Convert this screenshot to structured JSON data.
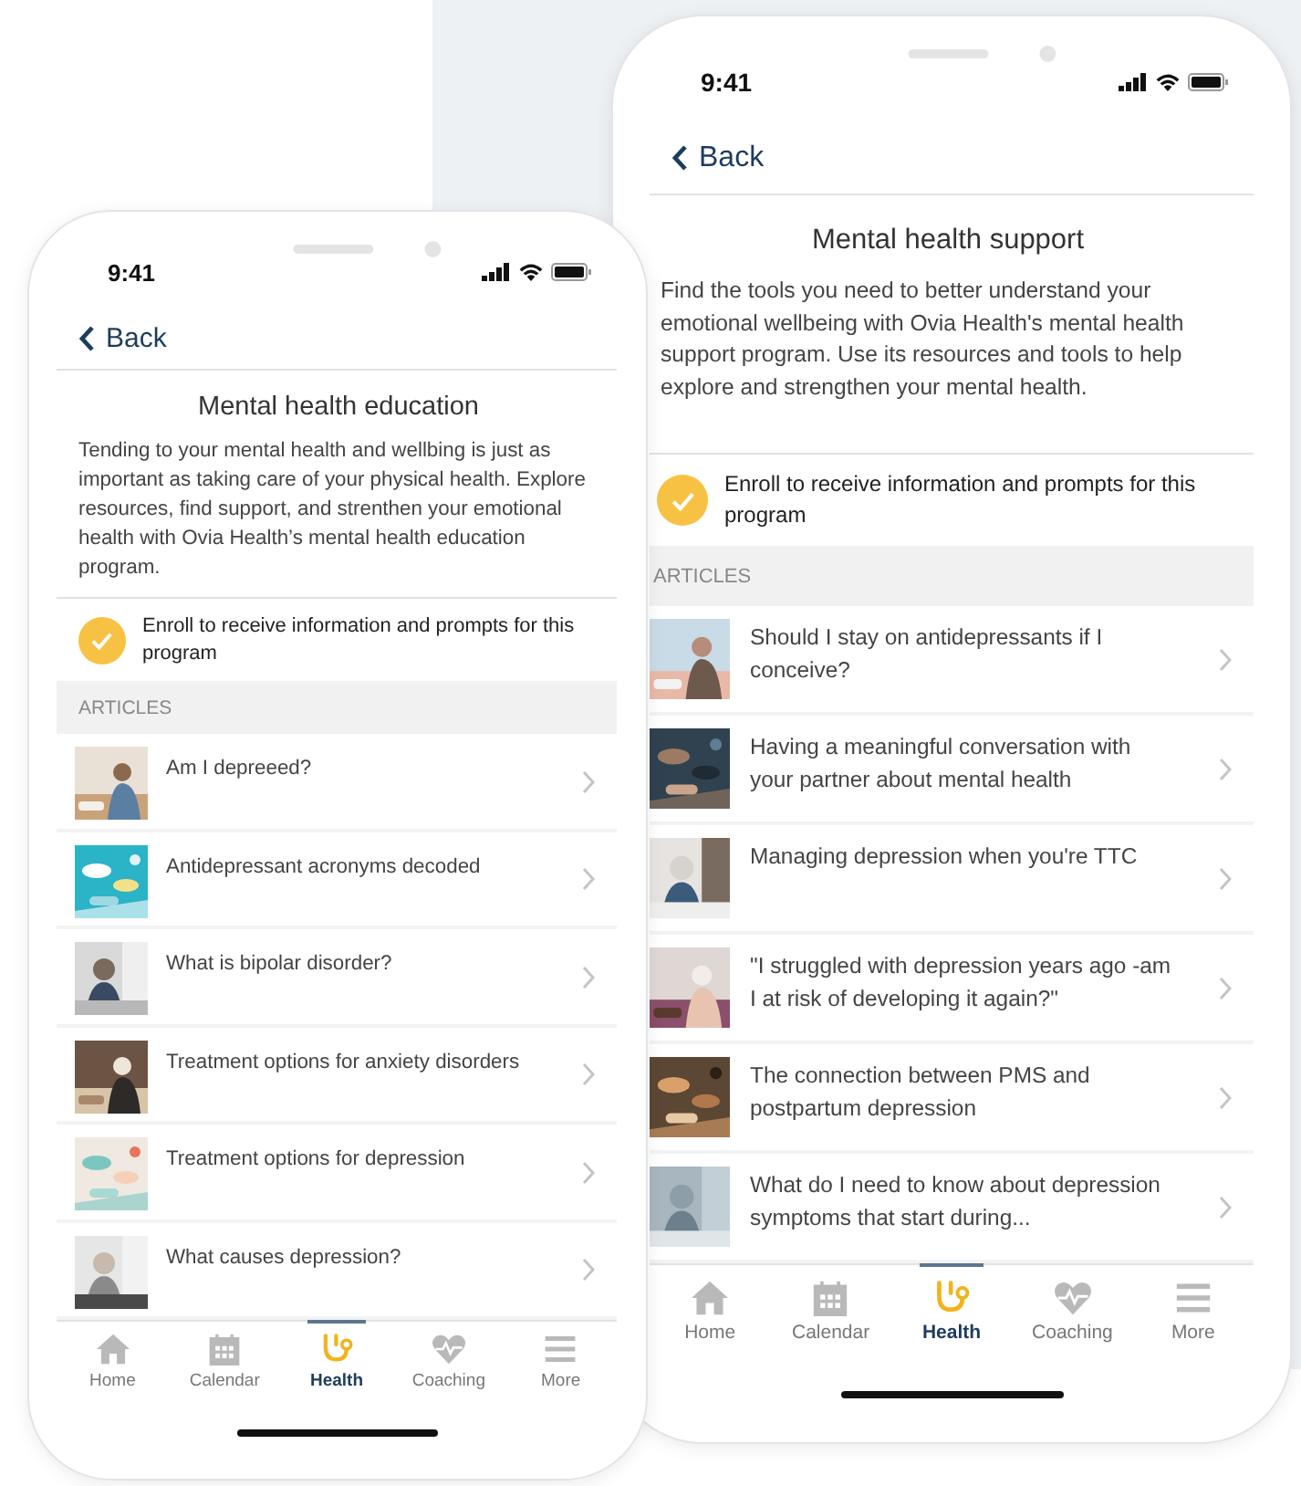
{
  "phones": [
    {
      "time": "9:41",
      "back": "Back",
      "title": "Mental health education",
      "description": "Tending to your mental health and wellbing is just as important as taking care of your physical health. Explore resources, find support, and strenthen your emotional health with Ovia Health’s mental health education program.",
      "enroll": {
        "text": "Enroll to receive information and prompts for this program",
        "checked": true
      },
      "section": "ARTICLES",
      "articles": [
        {
          "title": "Am I depreeed?"
        },
        {
          "title": "Antidepressant acronyms decoded"
        },
        {
          "title": "What is bipolar disorder?"
        },
        {
          "title": "Treatment options for anxiety disorders"
        },
        {
          "title": "Treatment options for depression"
        },
        {
          "title": "What causes depression?"
        }
      ],
      "tabs": [
        {
          "label": "Home",
          "kind": "home",
          "selected": false
        },
        {
          "label": "Calendar",
          "kind": "calendar",
          "selected": false
        },
        {
          "label": "Health",
          "kind": "health",
          "selected": true
        },
        {
          "label": "Coaching",
          "kind": "coaching",
          "selected": false
        },
        {
          "label": "More",
          "kind": "more",
          "selected": false
        }
      ]
    },
    {
      "time": "9:41",
      "back": "Back",
      "title": "Mental health support",
      "description": "Find the tools you need to better understand your emotional wellbeing with Ovia Health's mental health support program. Use its resources and tools to help explore and strengthen your mental health.",
      "enroll": {
        "text": "Enroll to receive information and prompts for this program",
        "checked": true
      },
      "section": "ARTICLES",
      "articles": [
        {
          "title": "Should I stay on antidepressants if I conceive?"
        },
        {
          "title": "Having a meaningful conversation with your partner about mental health"
        },
        {
          "title": "Managing depression when you're TTC"
        },
        {
          "title": "\"I struggled with depression years ago -am I at risk of developing it again?\""
        },
        {
          "title": "The connection between PMS and postpartum depression"
        },
        {
          "title": "What do I need to know about depression symptoms that start during..."
        }
      ],
      "tabs": [
        {
          "label": "Home",
          "kind": "home",
          "selected": false
        },
        {
          "label": "Calendar",
          "kind": "calendar",
          "selected": false
        },
        {
          "label": "Health",
          "kind": "health",
          "selected": true
        },
        {
          "label": "Coaching",
          "kind": "coaching",
          "selected": false
        },
        {
          "label": "More",
          "kind": "more",
          "selected": false
        }
      ]
    }
  ]
}
